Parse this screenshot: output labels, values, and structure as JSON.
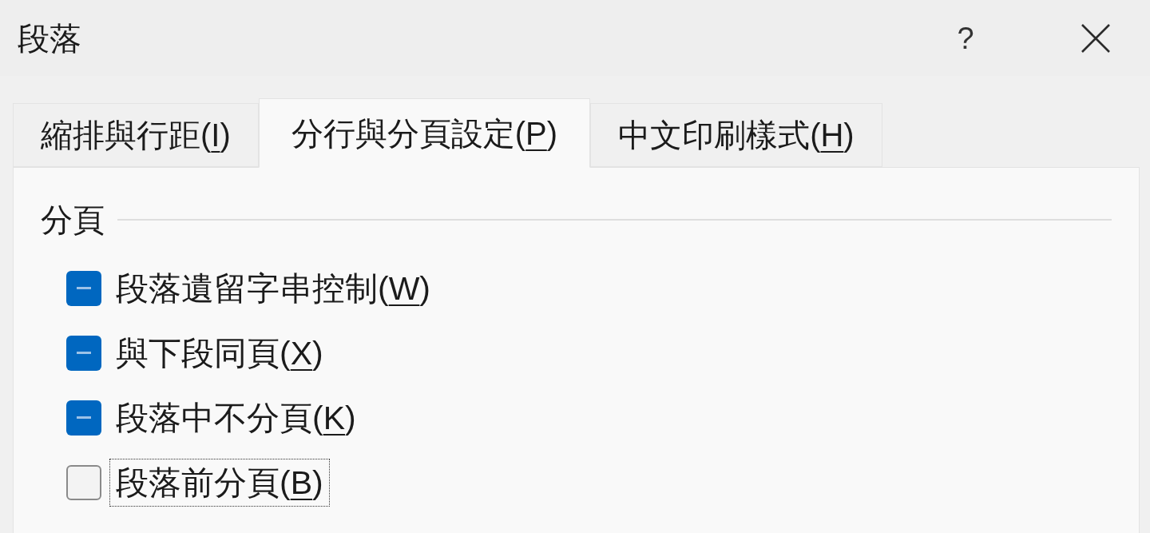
{
  "window": {
    "title": "段落",
    "help_button": "?"
  },
  "tabs": [
    {
      "before": "縮排與行距(",
      "access_key": "I",
      "after": ")",
      "selected": false
    },
    {
      "before": "分行與分頁設定(",
      "access_key": "P",
      "after": ")",
      "selected": true
    },
    {
      "before": "中文印刷樣式(",
      "access_key": "H",
      "after": ")",
      "selected": false
    }
  ],
  "pagination": {
    "heading": "分頁",
    "options": [
      {
        "before": "段落遺留字串控制(",
        "access_key": "W",
        "after": ")",
        "indeterminate": true,
        "focused": false
      },
      {
        "before": "與下段同頁(",
        "access_key": "X",
        "after": ")",
        "indeterminate": true,
        "focused": false
      },
      {
        "before": "段落中不分頁(",
        "access_key": "K",
        "after": ")",
        "indeterminate": true,
        "focused": false
      },
      {
        "before": "段落前分頁(",
        "access_key": "B",
        "after": ")",
        "indeterminate": false,
        "focused": true
      }
    ]
  }
}
